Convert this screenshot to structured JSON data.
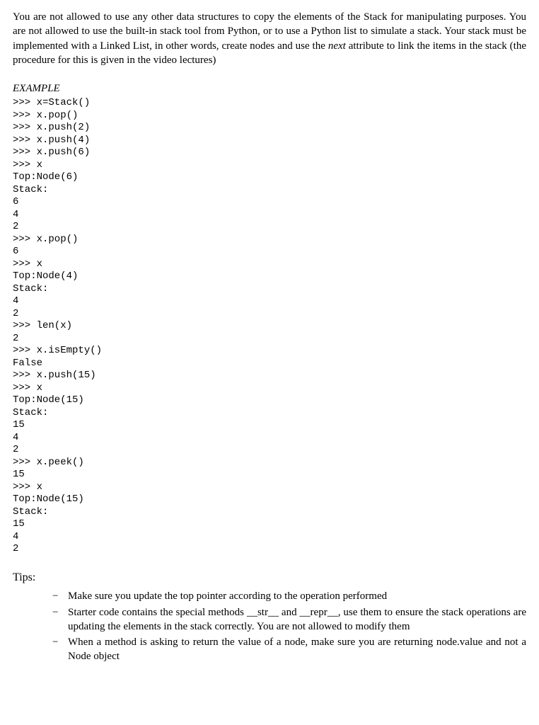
{
  "intro": {
    "part1": "You are not allowed to use any other data structures to copy the elements of the Stack for manipulating purposes. You are not allowed to use the built-in stack tool from Python, or to use a Python list to simulate a stack. Your stack must be implemented with a Linked List, in other words, create nodes and use the ",
    "italic": "next",
    "part2": " attribute to link the items in the stack (the procedure for this is given in the video lectures)"
  },
  "example_heading": "EXAMPLE",
  "code": ">>> x=Stack()\n>>> x.pop()\n>>> x.push(2)\n>>> x.push(4)\n>>> x.push(6)\n>>> x\nTop:Node(6)\nStack:\n6\n4\n2\n>>> x.pop()\n6\n>>> x\nTop:Node(4)\nStack:\n4\n2\n>>> len(x)\n2\n>>> x.isEmpty()\nFalse\n>>> x.push(15)\n>>> x\nTop:Node(15)\nStack:\n15\n4\n2\n>>> x.peek()\n15\n>>> x\nTop:Node(15)\nStack:\n15\n4\n2",
  "tips_heading": "Tips:",
  "tips": [
    "Make sure you update the top pointer according to the operation performed",
    "Starter code contains the special methods __str__ and __repr__, use them to ensure the stack operations are updating the elements in the stack correctly. You are not allowed to modify them",
    "When a method is asking to return the value of a node, make sure you are returning node.value and not a Node object"
  ]
}
